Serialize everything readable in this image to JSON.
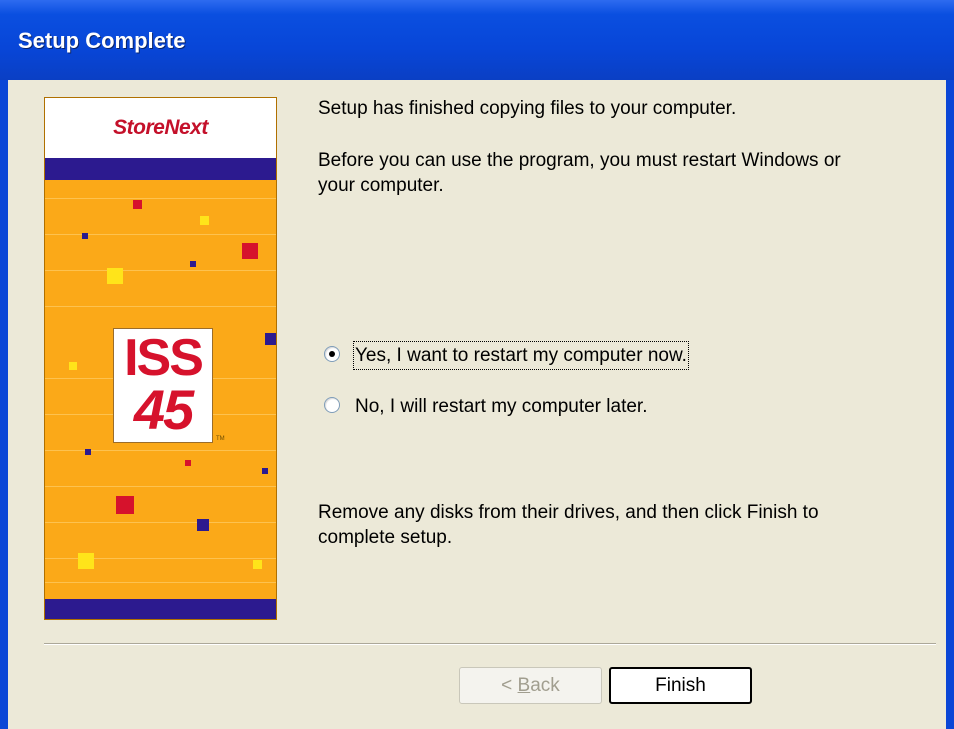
{
  "window": {
    "title": "Setup Complete"
  },
  "banner": {
    "brand": "StoreNext",
    "logo_line1": "ISS",
    "logo_line2": "45",
    "trademark": "TM",
    "colors": {
      "orange": "#fba918",
      "navy": "#2c1a8f",
      "red": "#c4102a"
    }
  },
  "content": {
    "line1": "Setup has finished copying files to your computer.",
    "line2a": "Before you can use the program, you must restart Windows or",
    "line2b": "your computer.",
    "options": [
      {
        "label": "Yes, I want to restart my computer now.",
        "selected": true
      },
      {
        "label": "No, I will restart my computer later.",
        "selected": false
      }
    ],
    "footer_a": "Remove any disks from their drives, and then click Finish to",
    "footer_b": "complete setup."
  },
  "buttons": {
    "back_prefix": "< ",
    "back_accel": "B",
    "back_rest": "ack",
    "finish": "Finish"
  }
}
